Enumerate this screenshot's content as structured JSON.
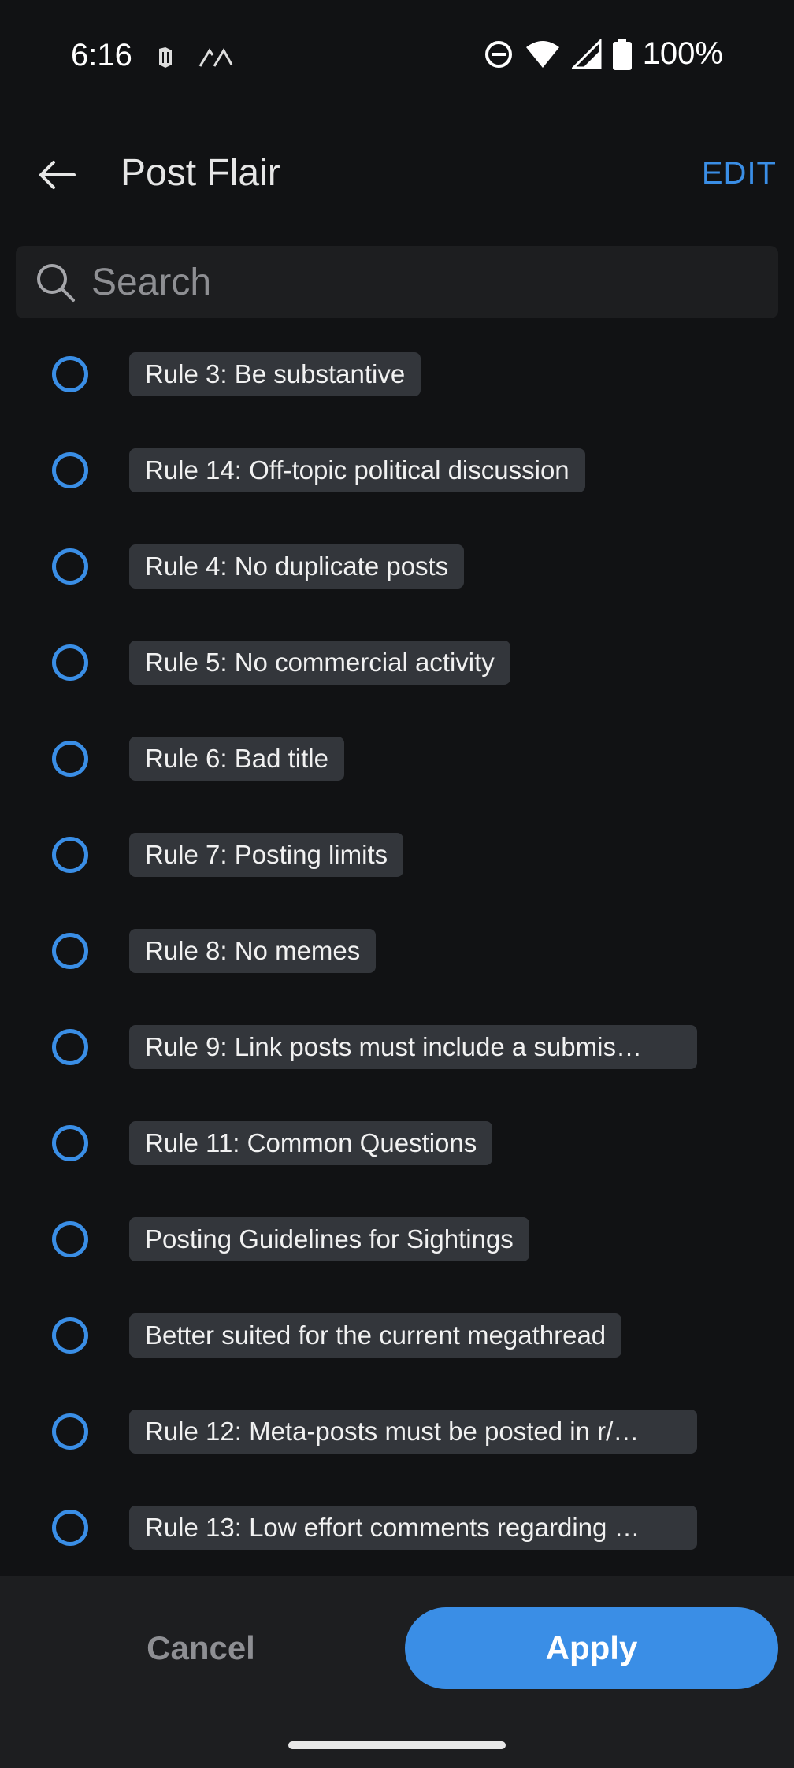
{
  "status_bar": {
    "time": "6:16",
    "battery": "100%"
  },
  "app_bar": {
    "title": "Post Flair",
    "edit_label": "EDIT"
  },
  "search": {
    "placeholder": "Search",
    "value": ""
  },
  "flairs": [
    {
      "label": "Rule 3: Be substantive",
      "selected": false
    },
    {
      "label": "Rule 14: Off-topic political discussion",
      "selected": false
    },
    {
      "label": "Rule 4: No duplicate posts",
      "selected": false
    },
    {
      "label": "Rule 5: No commercial activity",
      "selected": false
    },
    {
      "label": "Rule 6: Bad title",
      "selected": false
    },
    {
      "label": "Rule 7: Posting limits",
      "selected": false
    },
    {
      "label": "Rule 8: No memes",
      "selected": false
    },
    {
      "label": "Rule 9: Link posts must include a submis…",
      "selected": false
    },
    {
      "label": "Rule 11: Common Questions",
      "selected": false
    },
    {
      "label": "Posting Guidelines for Sightings",
      "selected": false
    },
    {
      "label": "Better suited for the current megathread",
      "selected": false
    },
    {
      "label": "Rule 12: Meta-posts must be posted in r/…",
      "selected": false
    },
    {
      "label": "Rule 13: Low effort comments regarding …",
      "selected": false
    }
  ],
  "footer": {
    "cancel_label": "Cancel",
    "apply_label": "Apply"
  },
  "colors": {
    "background": "#111214",
    "accent": "#3a8ee6",
    "chip": "#33363b",
    "surface": "#1d1e20"
  }
}
